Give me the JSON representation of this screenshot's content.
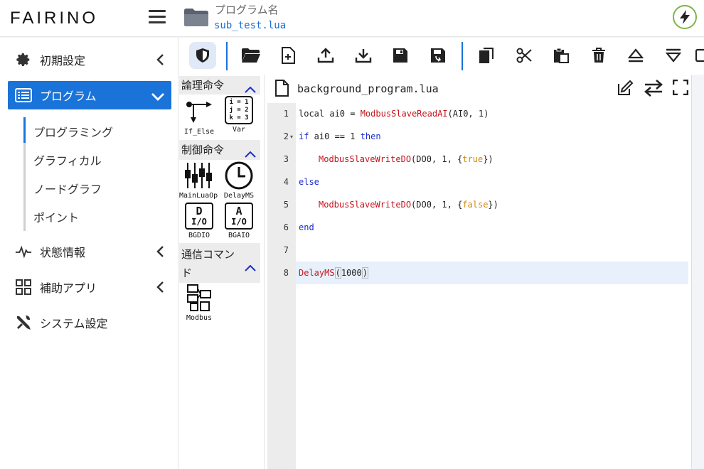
{
  "header": {
    "logo": "FAIRINO",
    "program_label": "プログラム名",
    "program_file": "sub_test.lua"
  },
  "sidebar": {
    "items": [
      {
        "label": "初期設定",
        "icon": "gear-icon"
      },
      {
        "label": "プログラム",
        "icon": "list-icon",
        "active": true
      },
      {
        "label": "状態情報",
        "icon": "pulse-icon"
      },
      {
        "label": "補助アプリ",
        "icon": "grid-icon"
      },
      {
        "label": "システム設定",
        "icon": "tools-icon"
      }
    ],
    "sub_items": [
      "プログラミング",
      "グラフィカル",
      "ノードグラフ",
      "ポイント"
    ]
  },
  "toolbar": {
    "buttons": [
      "shield-icon",
      "folder-open-icon",
      "new-file-icon",
      "upload-icon",
      "download-icon",
      "save-icon",
      "save-as-icon",
      "copy-icon",
      "cut-icon",
      "paste-icon",
      "delete-icon",
      "move-up-icon",
      "move-down-icon"
    ]
  },
  "palette": {
    "sections": [
      {
        "title": "論理命令",
        "blocks": [
          "If_Else",
          "Var"
        ]
      },
      {
        "title": "制御命令",
        "blocks": [
          "MainLuaOp",
          "DelayMS",
          "BGDIO",
          "BGAIO"
        ]
      },
      {
        "title": "通信コマンド",
        "blocks": [
          "Modbus"
        ]
      }
    ],
    "var_text": [
      "i = 1",
      "j = 2",
      "k = 3"
    ],
    "io_letters": [
      "D",
      "A"
    ],
    "io_text": "I/O"
  },
  "editor": {
    "filename": "background_program.lua",
    "line_numbers": [
      "1",
      "2",
      "3",
      "4",
      "5",
      "6",
      "7",
      "8"
    ],
    "code": {
      "l1_a": "local ai0 = ",
      "l1_fn": "ModbusSlaveReadAI",
      "l1_b": "(AI0, 1)",
      "l2_kw1": "if",
      "l2_a": " ai0 == 1 ",
      "l2_kw2": "then",
      "l3_fn": "ModbusSlaveWriteDO",
      "l3_a": "(DO0, 1, {",
      "l3_bool": "true",
      "l3_b": "})",
      "l4_kw": "else",
      "l5_fn": "ModbusSlaveWriteDO",
      "l5_a": "(DO0, 1, {",
      "l5_bool": "false",
      "l5_b": "})",
      "l6_kw": "end",
      "l8_fn": "DelayMS",
      "l8_arg": "1000"
    }
  },
  "colors": {
    "accent": "#1a73d9",
    "keyword": "#1a2ec9",
    "function": "#c6141d",
    "boolean": "#d58a0b",
    "status_ok": "#7ab648"
  }
}
